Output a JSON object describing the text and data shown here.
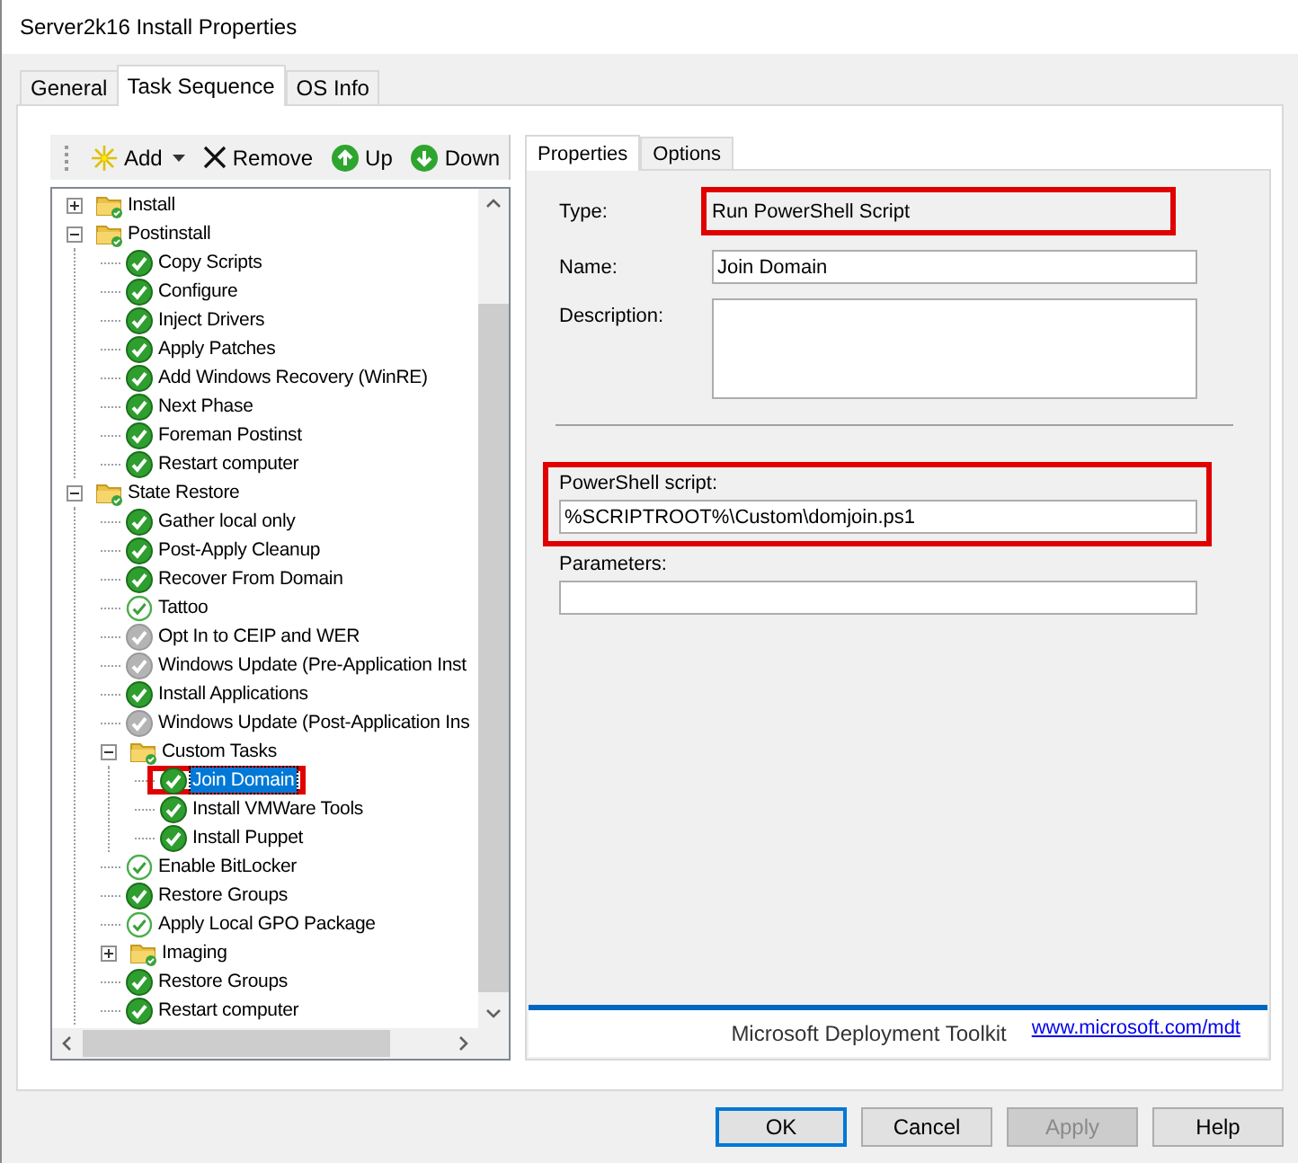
{
  "window": {
    "title": "Server2k16 Install Properties"
  },
  "tabs": [
    {
      "label": "General",
      "selected": false
    },
    {
      "label": "Task Sequence",
      "selected": true
    },
    {
      "label": "OS Info",
      "selected": false
    }
  ],
  "toolbar": [
    {
      "kind": "add",
      "label": "Add",
      "dropdown": true
    },
    {
      "kind": "remove",
      "label": "Remove"
    },
    {
      "kind": "up",
      "label": "Up"
    },
    {
      "kind": "down",
      "label": "Down"
    }
  ],
  "tree": [
    {
      "kind": "group",
      "label": "Install",
      "expanded": false
    },
    {
      "kind": "group",
      "label": "Postinstall",
      "expanded": true,
      "children": [
        {
          "kind": "step",
          "label": "Copy Scripts"
        },
        {
          "kind": "step",
          "label": "Configure"
        },
        {
          "kind": "step",
          "label": "Inject Drivers"
        },
        {
          "kind": "step",
          "label": "Apply Patches"
        },
        {
          "kind": "step",
          "label": "Add Windows Recovery (WinRE)"
        },
        {
          "kind": "step",
          "label": "Next Phase"
        },
        {
          "kind": "step",
          "label": "Foreman Postinst"
        },
        {
          "kind": "step",
          "label": "Restart computer"
        }
      ]
    },
    {
      "kind": "group",
      "label": "State Restore",
      "expanded": true,
      "children": [
        {
          "kind": "step",
          "label": "Gather local only"
        },
        {
          "kind": "step",
          "label": "Post-Apply Cleanup"
        },
        {
          "kind": "step",
          "label": "Recover From Domain"
        },
        {
          "kind": "light-step",
          "label": "Tattoo"
        },
        {
          "kind": "disabled-step",
          "label": "Opt In to CEIP and WER"
        },
        {
          "kind": "disabled-step",
          "label": "Windows Update (Pre-Application Inst"
        },
        {
          "kind": "step",
          "label": "Install Applications"
        },
        {
          "kind": "disabled-step",
          "label": "Windows Update (Post-Application Ins"
        },
        {
          "kind": "group",
          "label": "Custom Tasks",
          "expanded": true,
          "children": [
            {
              "kind": "step",
              "label": "Join Domain",
              "selected": true,
              "highlighted": true
            },
            {
              "kind": "step",
              "label": "Install VMWare Tools",
              "selected": false,
              "highlighted": false
            },
            {
              "kind": "step",
              "label": "Install Puppet",
              "selected": false,
              "highlighted": false
            }
          ]
        },
        {
          "kind": "light-step",
          "label": "Enable BitLocker"
        },
        {
          "kind": "step",
          "label": "Restore Groups"
        },
        {
          "kind": "light-step",
          "label": "Apply Local GPO Package"
        },
        {
          "kind": "group",
          "label": "Imaging",
          "expanded": false
        },
        {
          "kind": "step",
          "label": "Restore Groups"
        },
        {
          "kind": "step",
          "label": "Restart computer"
        }
      ]
    }
  ],
  "detail_tabs": [
    {
      "label": "Properties",
      "selected": true
    },
    {
      "label": "Options",
      "selected": false
    }
  ],
  "properties": {
    "type": {
      "label": "Type:",
      "value": "Run PowerShell Script",
      "highlighted": true
    },
    "name": {
      "label": "Name:",
      "value": "Join Domain"
    },
    "description": {
      "label": "Description:"
    },
    "script": {
      "label": "PowerShell script:",
      "value": "%SCRIPTROOT%\\Custom\\domjoin.ps1",
      "highlighted": true
    },
    "parameters": {
      "label": "Parameters:"
    }
  },
  "footer": {
    "brand": "Microsoft Deployment Toolkit",
    "link": "www.microsoft.com/mdt"
  },
  "buttons": [
    {
      "label": "OK",
      "kind": "default",
      "disabled": false
    },
    {
      "label": "Cancel",
      "kind": "normal",
      "disabled": false
    },
    {
      "label": "Apply",
      "kind": "normal",
      "disabled": true
    },
    {
      "label": "Help",
      "kind": "normal",
      "disabled": false
    }
  ]
}
